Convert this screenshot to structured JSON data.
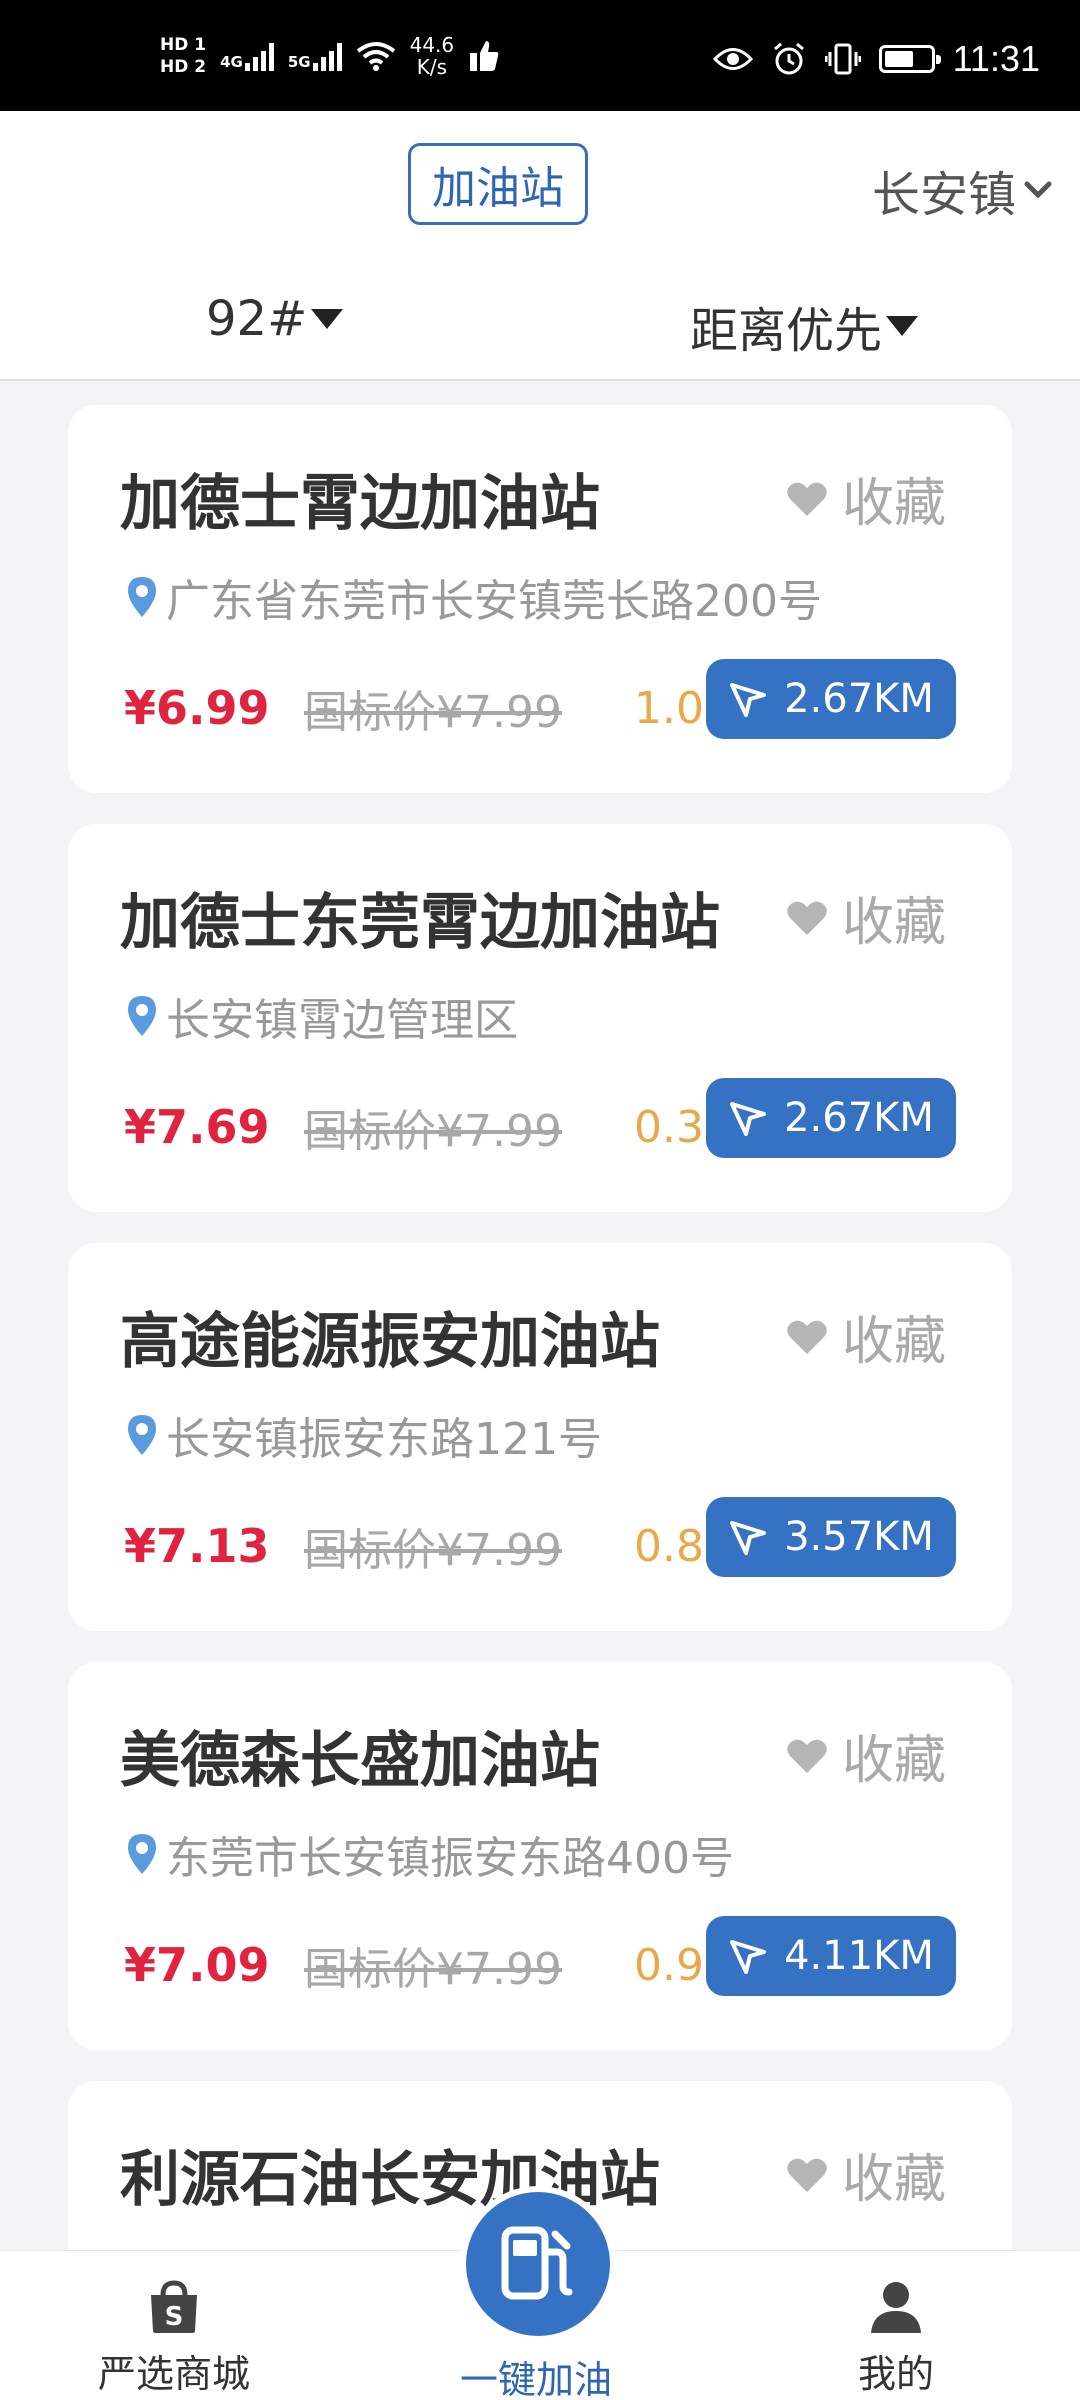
{
  "status_bar": {
    "hd1": "HD 1",
    "hd2": "HD 2",
    "net1": "4G",
    "net2": "5G",
    "speed_value": "44.6",
    "speed_unit": "K/s",
    "time": "11:31"
  },
  "header": {
    "title": "加油站",
    "town": "长安镇",
    "fuel_filter": "92#",
    "sort_filter": "距离优先"
  },
  "stations": [
    {
      "name": "加德士霄边加油站",
      "favorite_label": "收藏",
      "address": "广东省东莞市长安镇莞长路200号",
      "price": "¥6.99",
      "guide_price": "国标价¥7.99",
      "saving": "1.00",
      "distance": "2.67KM"
    },
    {
      "name": "加德士东莞霄边加油站",
      "favorite_label": "收藏",
      "address": "长安镇霄边管理区",
      "price": "¥7.69",
      "guide_price": "国标价¥7.99",
      "saving": "0.30",
      "distance": "2.67KM"
    },
    {
      "name": "高途能源振安加油站",
      "favorite_label": "收藏",
      "address": "长安镇振安东路121号",
      "price": "¥7.13",
      "guide_price": "国标价¥7.99",
      "saving": "0.86",
      "distance": "3.57KM"
    },
    {
      "name": "美德森长盛加油站",
      "favorite_label": "收藏",
      "address": "东莞市长安镇振安东路400号",
      "price": "¥7.09",
      "guide_price": "国标价¥7.99",
      "saving": "0.90",
      "distance": "4.11KM"
    },
    {
      "name": "利源石油长安加油站",
      "favorite_label": "收藏"
    }
  ],
  "bottom_nav": {
    "shop_label": "严选商城",
    "fuel_label": "一键加油",
    "mine_label": "我的"
  },
  "colors": {
    "accent_blue": "#3672c4",
    "price_red": "#e0243f",
    "saving_orange": "#e8a94a"
  }
}
